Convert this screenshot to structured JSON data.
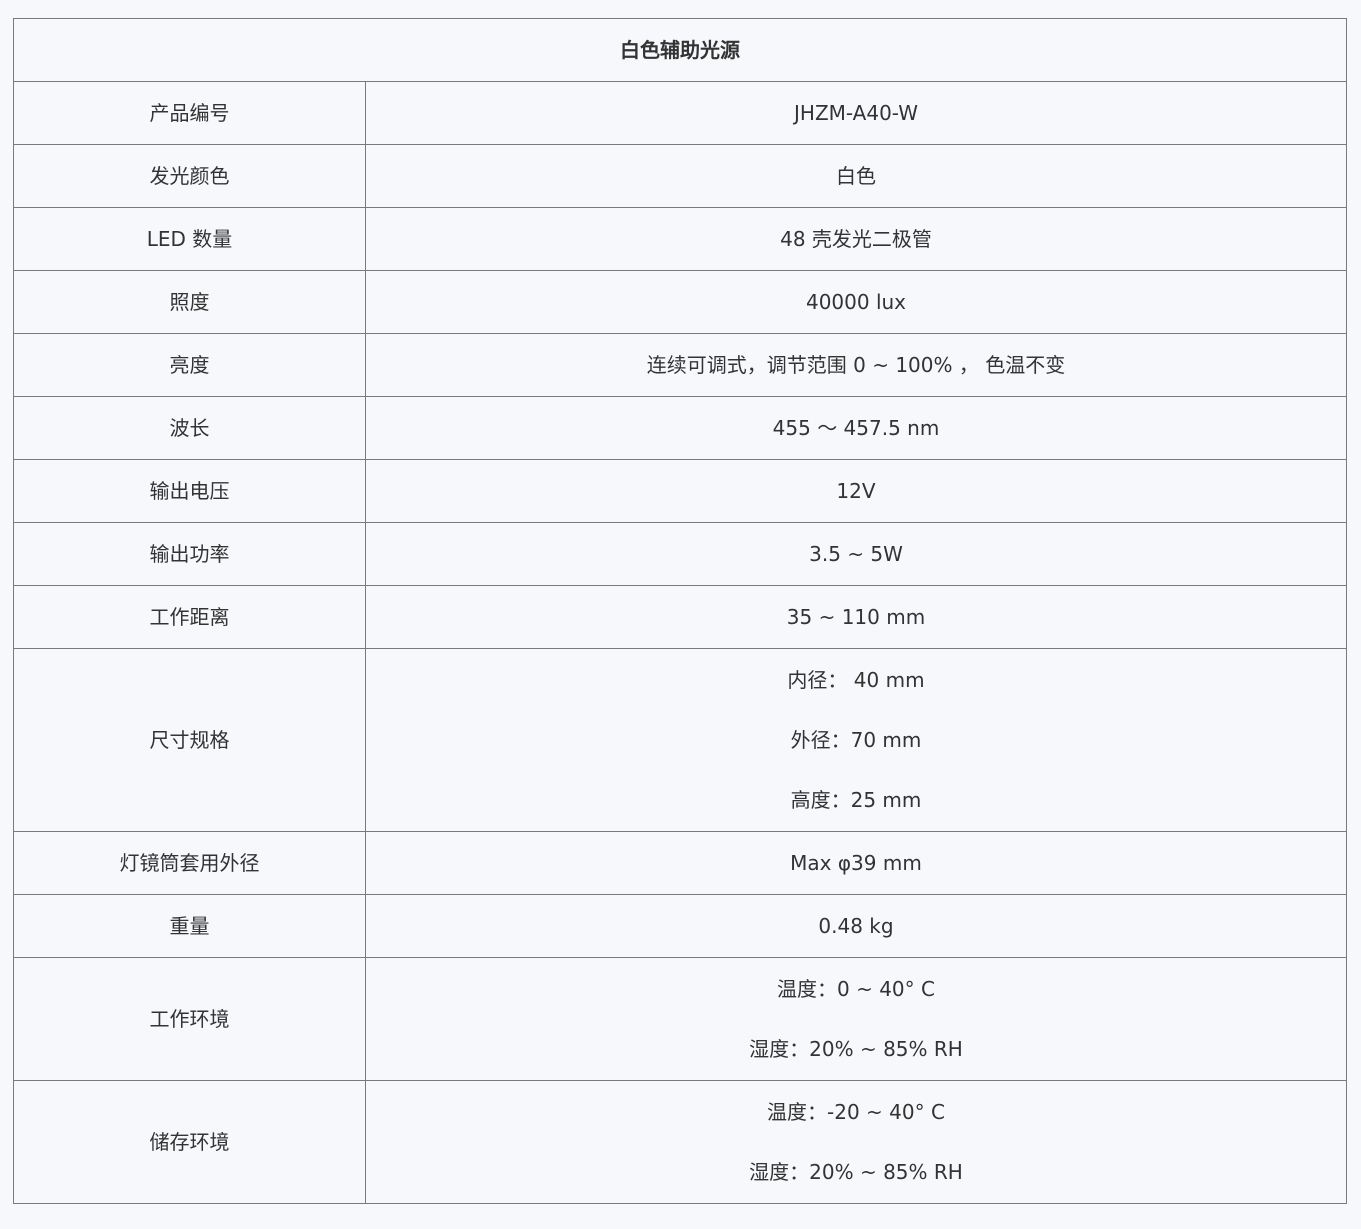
{
  "title": "白色辅助光源",
  "rows": [
    {
      "label": "产品编号",
      "values": [
        "JHZM-A40-W"
      ]
    },
    {
      "label": "发光颜色",
      "values": [
        "白色"
      ]
    },
    {
      "label": "LED 数量",
      "values": [
        "48 壳发光二极管"
      ]
    },
    {
      "label": "照度",
      "values": [
        "40000 lux"
      ]
    },
    {
      "label": "亮度",
      "values": [
        "连续可调式，调节范围 0 ~ 100% ， 色温不变"
      ]
    },
    {
      "label": "波长",
      "values": [
        "455 ～ 457.5 nm"
      ]
    },
    {
      "label": "输出电压",
      "values": [
        "12V"
      ]
    },
    {
      "label": "输出功率",
      "values": [
        "3.5 ~ 5W"
      ]
    },
    {
      "label": "工作距离",
      "values": [
        "35 ~ 110 mm"
      ]
    },
    {
      "label": "尺寸规格",
      "values": [
        "内径： 40 mm",
        "外径：70 mm",
        "高度：25 mm"
      ]
    },
    {
      "label": "灯镜筒套用外径",
      "values": [
        "Max φ39 mm"
      ]
    },
    {
      "label": "重量",
      "values": [
        "0.48 kg"
      ]
    },
    {
      "label": "工作环境",
      "values": [
        "温度：0 ~ 40° C",
        "湿度：20% ~ 85% RH"
      ]
    },
    {
      "label": "储存环境",
      "values": [
        "温度：-20 ~ 40° C",
        "湿度：20% ~ 85% RH"
      ]
    }
  ]
}
